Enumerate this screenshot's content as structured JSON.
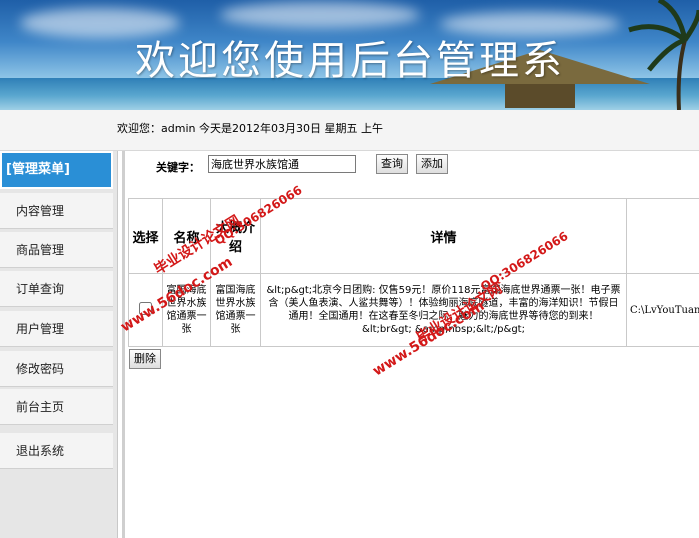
{
  "header": {
    "title": "欢迎您使用后台管理系"
  },
  "infobar": {
    "text": "欢迎您：admin   今天是2012年03月30日   星期五   上午"
  },
  "sidebar": {
    "heading": "[管理菜单]",
    "items": [
      {
        "label": "内容管理"
      },
      {
        "label": "商品管理"
      },
      {
        "label": "订单查询"
      },
      {
        "label": "用户管理"
      },
      {
        "label": "修改密码"
      },
      {
        "label": "前台主页"
      },
      {
        "label": "退出系统"
      }
    ]
  },
  "search": {
    "label": "关键字：",
    "value": "海底世界水族馆通",
    "query_button": "查询",
    "add_button": "添加"
  },
  "table": {
    "headers": {
      "select": "选择",
      "name": "名称",
      "intro": "大概介绍",
      "detail": "详情",
      "image": ""
    },
    "rows": [
      {
        "name": "富国海底世界水族馆通票一张",
        "intro": "富国海底世界水族馆通票一张",
        "detail": "&lt;p&gt;北京今日团购: 仅售59元！原价118元富国海底世界通票一张！电子票含（美人鱼表演、人鲨共舞等）！体验绚丽海底隧道，丰富的海洋知识！节假日通用！全国通用！在这春至冬归之际，魅力的海底世界等待您的到来！&lt;br&gt; &amp;nbsp;&lt;/p&gt;",
        "image": "C:\\LvYouTuan"
      }
    ],
    "delete_button": "删除"
  },
  "watermarks": {
    "site": "www.56doc.com",
    "name": "毕业设计论文网",
    "qq": "QQ:306826066"
  }
}
